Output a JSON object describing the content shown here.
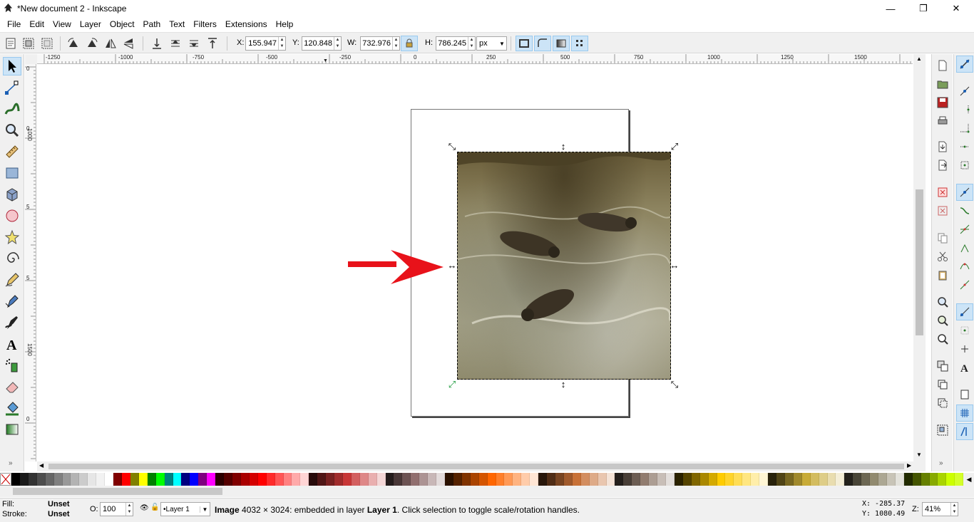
{
  "window": {
    "title": "*New document 2 - Inkscape",
    "minimize": "—",
    "maximize": "❐",
    "close": "✕"
  },
  "menu": [
    "File",
    "Edit",
    "View",
    "Layer",
    "Object",
    "Path",
    "Text",
    "Filters",
    "Extensions",
    "Help"
  ],
  "toolctrl": {
    "x_label": "X:",
    "x_value": "155.947",
    "y_label": "Y:",
    "y_value": "120.848",
    "w_label": "W:",
    "w_value": "732.976",
    "h_label": "H:",
    "h_value": "786.245",
    "unit": "px"
  },
  "ruler_top": [
    "-1250",
    "-1000",
    "-750",
    "-500",
    "-250",
    "0",
    "250",
    "500",
    "750",
    "1000",
    "1250",
    "1500"
  ],
  "ruler_left": [
    "0",
    "0",
    "5",
    "1000",
    "5",
    "1500",
    "0"
  ],
  "palette_colors": [
    "#000000",
    "#1a1a1a",
    "#333333",
    "#4d4d4d",
    "#666666",
    "#808080",
    "#999999",
    "#b3b3b3",
    "#cccccc",
    "#e6e6e6",
    "#f2f2f2",
    "#ffffff",
    "#800000",
    "#ff0000",
    "#808000",
    "#ffff00",
    "#008000",
    "#00ff00",
    "#008080",
    "#00ffff",
    "#000080",
    "#0000ff",
    "#800080",
    "#ff00ff",
    "#2b0000",
    "#550000",
    "#800000",
    "#aa0000",
    "#d40000",
    "#ff0000",
    "#ff2a2a",
    "#ff5555",
    "#ff8080",
    "#ffaaaa",
    "#ffd5d5",
    "#280b0b",
    "#501616",
    "#782121",
    "#a02c2c",
    "#c83737",
    "#d35f5f",
    "#de8787",
    "#e9afaf",
    "#f4d7d7",
    "#241c1c",
    "#483737",
    "#6c5353",
    "#916f6f",
    "#ac9393",
    "#c8b7b7",
    "#e3dbdb",
    "#2b1100",
    "#552200",
    "#803300",
    "#aa4400",
    "#d45500",
    "#ff6600",
    "#ff7f2a",
    "#ff9955",
    "#ffb380",
    "#ffccaa",
    "#ffe6d5",
    "#28170b",
    "#502d16",
    "#784421",
    "#a05a2c",
    "#c87137",
    "#d38d5f",
    "#deaa87",
    "#e9c6af",
    "#f4e3d7",
    "#241f1c",
    "#483e37",
    "#6c5d53",
    "#917c6f",
    "#ac9d93",
    "#c8beb7",
    "#e3dedb",
    "#2b2200",
    "#554400",
    "#806600",
    "#aa8800",
    "#d4aa00",
    "#ffcc00",
    "#ffd42a",
    "#ffdd55",
    "#ffe680",
    "#ffeeaa",
    "#fff6d5",
    "#28220b",
    "#504416",
    "#786721",
    "#a0892c",
    "#c8ab37",
    "#d3bc5f",
    "#decd87",
    "#e9ddaf",
    "#f4eed7",
    "#24221c",
    "#484537",
    "#6c6753",
    "#918a6f",
    "#aca793",
    "#c8c4b7",
    "#e3e2db",
    "#222b00",
    "#445500",
    "#668000",
    "#88aa00",
    "#aad400",
    "#ccff00",
    "#d4ff2a"
  ],
  "status": {
    "fill_label": "Fill:",
    "fill_value": "Unset",
    "stroke_label": "Stroke:",
    "stroke_value": "Unset",
    "opacity_label": "O:",
    "opacity_value": "100",
    "layer": "•Layer 1",
    "message_bold": "Image",
    "message": " 4032 × 3024: embedded in layer ",
    "message_layer": "Layer 1",
    "message_tail": ". Click selection to toggle scale/rotation handles.",
    "coord_x": "X: -285.37",
    "coord_y": "Y: 1080.49",
    "zoom_label": "Z:",
    "zoom_value": "41%"
  }
}
